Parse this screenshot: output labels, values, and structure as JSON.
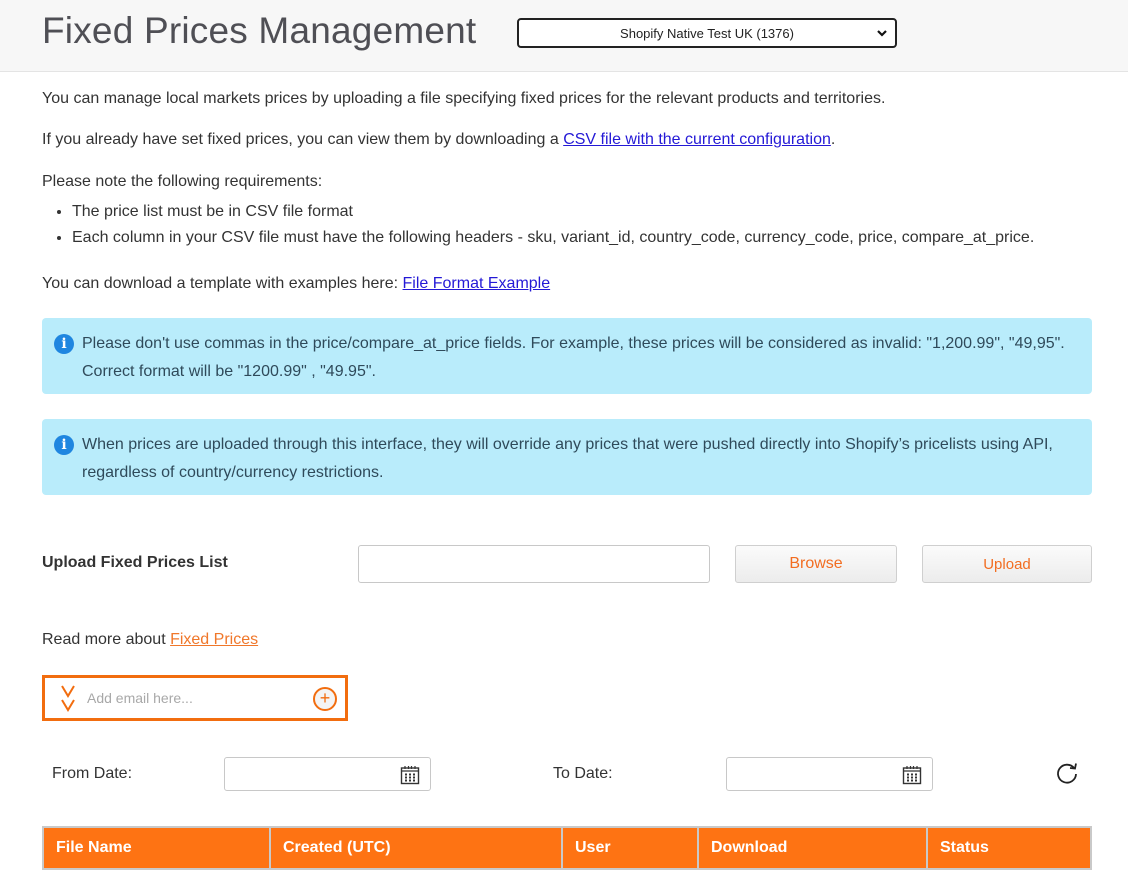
{
  "header": {
    "title": "Fixed Prices Management",
    "store_select": {
      "selected": "Shopify Native Test UK (1376)"
    }
  },
  "intro": {
    "line1": "You can manage local markets prices by uploading a file specifying fixed prices for the relevant products and territories.",
    "line2_prefix": "If you already have set fixed prices, you can view them by downloading a ",
    "line2_link": "CSV file with the current configuration",
    "line2_suffix": ".",
    "requirements_title": "Please note the following requirements:",
    "requirements": [
      "The price list must be in CSV file format",
      "Each column in your CSV file must have the following headers - sku, variant_id, country_code, currency_code, price, compare_at_price."
    ],
    "template_prefix": "You can download a template with examples here: ",
    "template_link": "File Format Example"
  },
  "alerts": [
    {
      "icon": "info-icon",
      "text": "Please don't use commas in the price/compare_at_price fields. For example, these prices will be considered as invalid: \"1,200.99\", \"49,95\". Correct format will be \"1200.99\" , \"49.95\"."
    },
    {
      "icon": "info-icon",
      "text": "When prices are uploaded through this interface, they will override any prices that were pushed directly into Shopify’s pricelists using API, regardless of country/currency restrictions."
    }
  ],
  "upload": {
    "label": "Upload Fixed Prices List",
    "file_value": "",
    "browse_label": "Browse",
    "upload_label": "Upload"
  },
  "read_more": {
    "prefix": "Read more about ",
    "link": "Fixed Prices"
  },
  "email": {
    "placeholder": "Add email here...",
    "value": "",
    "add_symbol": "+"
  },
  "filters": {
    "from_label": "From Date:",
    "from_value": "",
    "to_label": "To Date:",
    "to_value": ""
  },
  "table": {
    "columns": [
      "File Name",
      "Created (UTC)",
      "User",
      "Download",
      "Status"
    ],
    "rows": []
  },
  "colors": {
    "accent": "#fe7313",
    "alert_bg": "#b9ecfb",
    "link": "#2419d6"
  }
}
